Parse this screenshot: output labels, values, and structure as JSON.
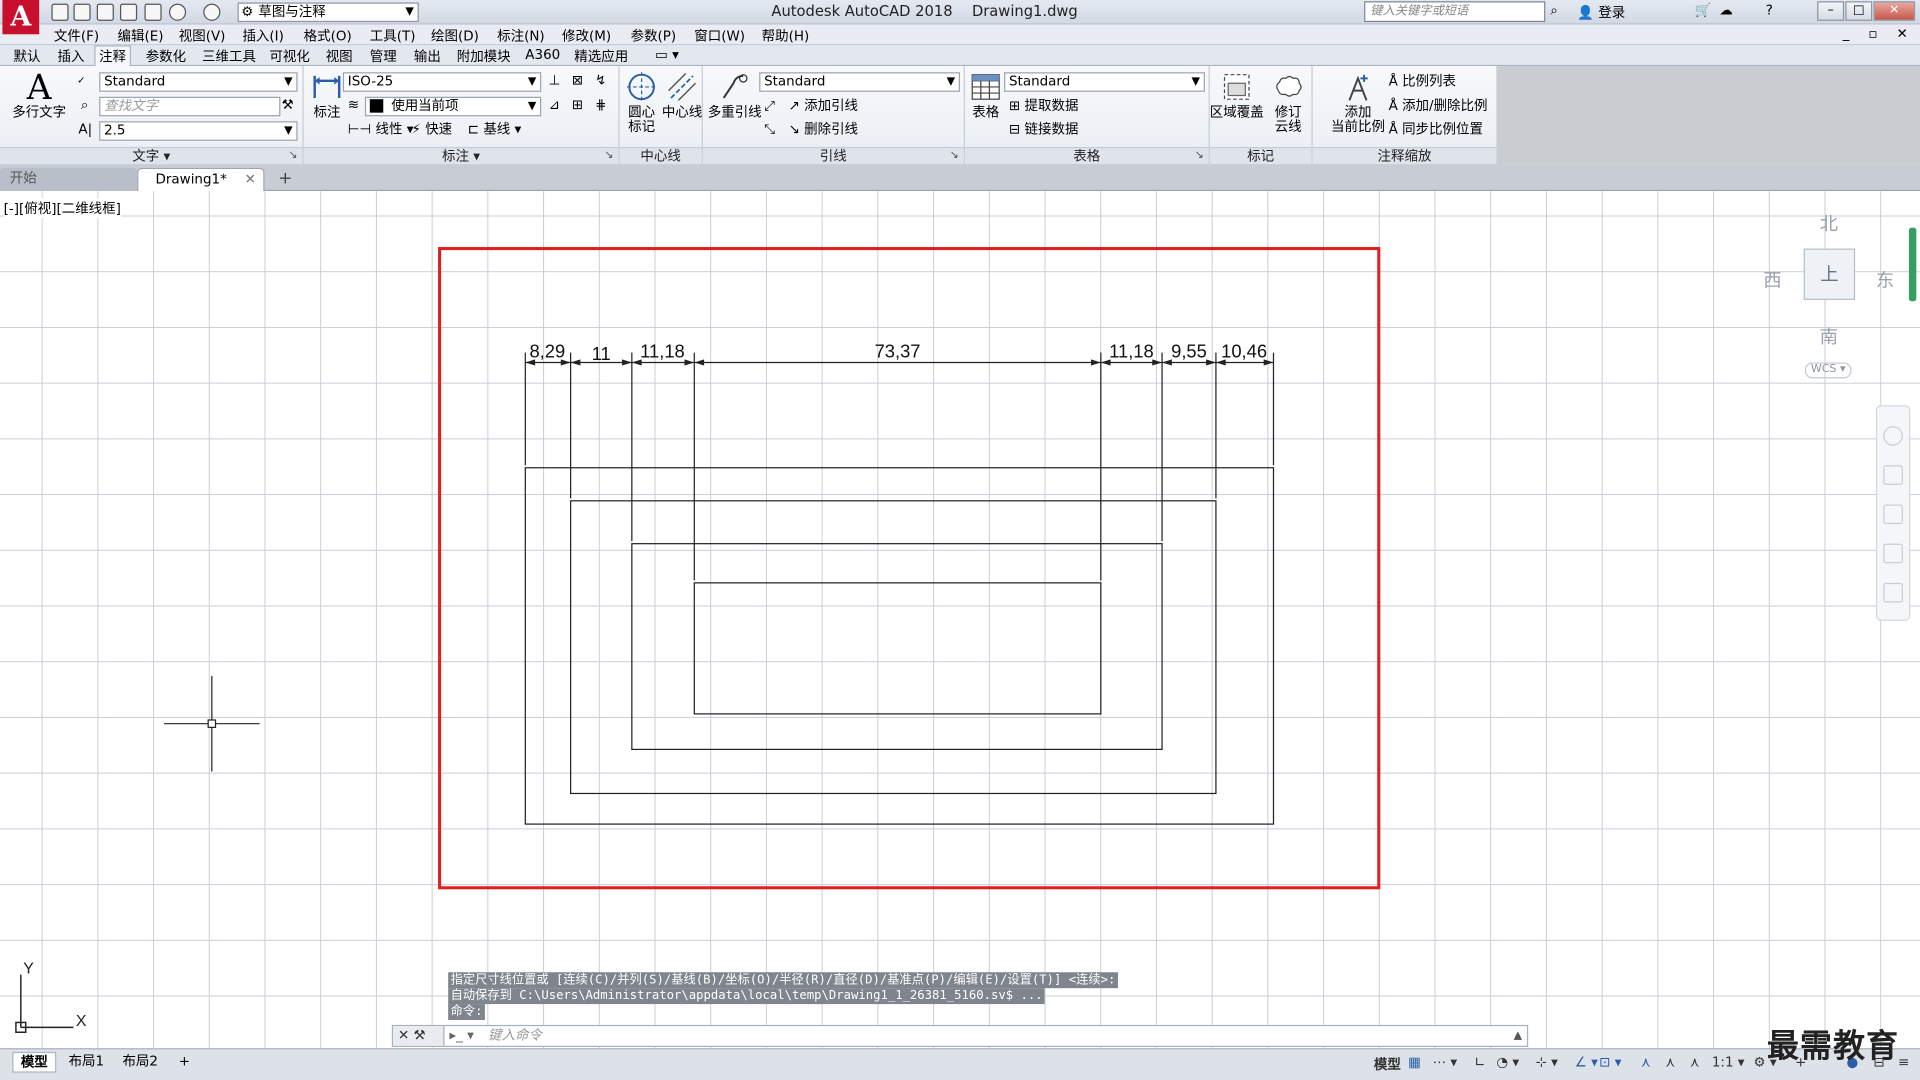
{
  "app": {
    "title": "Autodesk AutoCAD 2018",
    "document": "Drawing1.dwg",
    "logo": "A",
    "workspace": "草图与注释",
    "search_placeholder": "键入关键字或短语",
    "login": "登录"
  },
  "menu": [
    "文件(F)",
    "编辑(E)",
    "视图(V)",
    "插入(I)",
    "格式(O)",
    "工具(T)",
    "绘图(D)",
    "标注(N)",
    "修改(M)",
    "参数(P)",
    "窗口(W)",
    "帮助(H)"
  ],
  "ribbon_tabs": [
    "默认",
    "插入",
    "注释",
    "参数化",
    "三维工具",
    "可视化",
    "视图",
    "管理",
    "输出",
    "附加模块",
    "A360",
    "精选应用"
  ],
  "active_tab": "注释",
  "ribbon": {
    "text_panel": {
      "title": "文字",
      "mtext_label": "多行文字",
      "style": "Standard",
      "find_placeholder": "查找文字",
      "height": "2.5"
    },
    "dim_panel": {
      "title": "标注",
      "dim_label": "标注",
      "dim_style": "ISO-25",
      "layer": "使用当前项",
      "linear": "线性",
      "quick": "快速",
      "baseline": "基线"
    },
    "centerline_panel": {
      "title": "中心线",
      "center_mark": "圆心\n标记",
      "centerline": "中心线"
    },
    "leader_panel": {
      "title": "引线",
      "mleader": "多重引线",
      "style": "Standard",
      "add": "添加引线",
      "remove": "删除引线"
    },
    "table_panel": {
      "title": "表格",
      "table": "表格",
      "style": "Standard",
      "extract": "提取数据",
      "link": "链接数据"
    },
    "markup_panel": {
      "title": "标记",
      "wipeout": "区域覆盖",
      "revcloud": "修订\n云线"
    },
    "scale_panel": {
      "title": "注释缩放",
      "add_scale": "添加\n当前比例",
      "scale_list": "比例列表",
      "add_delete": "添加/删除比例",
      "sync": "同步比例位置"
    }
  },
  "doc_tabs": {
    "start": "开始",
    "active": "Drawing1*"
  },
  "view_label": "[-][俯视][二维线框]",
  "viewcube": {
    "north": "北",
    "south": "南",
    "east": "东",
    "west": "西",
    "top": "上",
    "wcs": "WCS"
  },
  "dimensions": [
    "8,29",
    "11",
    "11,18",
    "73,37",
    "11,18",
    "9,55",
    "10,46"
  ],
  "highlight_color": "#e02020",
  "command": {
    "history": [
      "指定尺寸线位置或 [连续(C)/并列(S)/基线(B)/坐标(O)/半径(R)/直径(D)/基准点(P)/编辑(E)/设置(T)] <连续>:",
      "自动保存到 C:\\Users\\Administrator\\appdata\\local\\temp\\Drawing1_1_26381_5160.sv$ ...",
      "命令:"
    ],
    "placeholder": "键入命令"
  },
  "ucs": {
    "x": "X",
    "y": "Y"
  },
  "layout_tabs": [
    "模型",
    "布局1",
    "布局2"
  ],
  "status": {
    "model": "模型",
    "scale": "1:1"
  },
  "watermark": "最需教育"
}
